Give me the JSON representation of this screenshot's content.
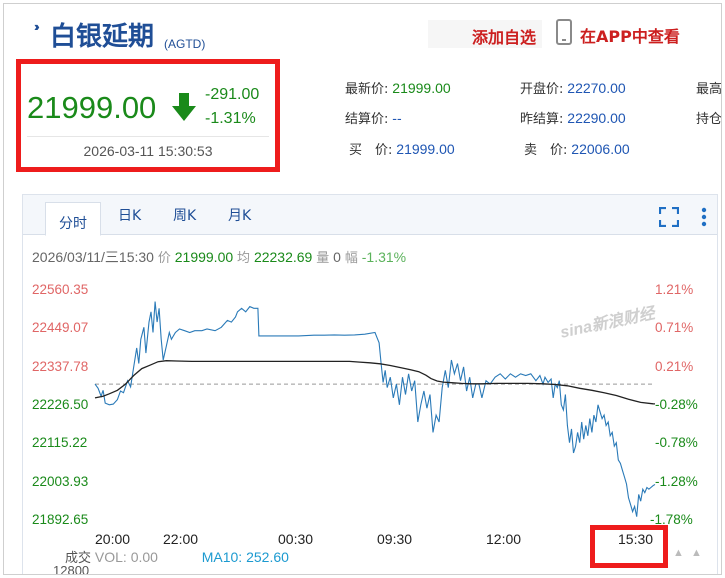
{
  "header": {
    "title": "白银延期",
    "code": "(AGTD)",
    "add_favorite": "添加自选",
    "app_link": "在APP中查看"
  },
  "price_box": {
    "price": "21999.00",
    "change": "-291.00",
    "change_pct": "-1.31%",
    "datetime": "2026-03-11 15:30:53"
  },
  "quote": {
    "latest_label": "最新价:",
    "latest": "21999.00",
    "settle_label": "结算价:",
    "settle": "--",
    "bid_label": "买　价:",
    "bid": "21999.00",
    "open_label": "开盘价:",
    "open": "22270.00",
    "prev_settle_label": "昨结算:",
    "prev_settle": "22290.00",
    "ask_label": "卖　价:",
    "ask": "22006.00",
    "high_label": "最高",
    "hold_label": "持仓"
  },
  "tabs": [
    "分时",
    "日K",
    "周K",
    "月K"
  ],
  "info_line": {
    "datetime": "2026/03/11/三15:30",
    "price_label": "价",
    "price": "21999.00",
    "avg_label": "均",
    "avg": "22232.69",
    "vol_label": "量",
    "vol": "0",
    "range_label": "幅",
    "range": "-1.31%"
  },
  "volume": {
    "label": "成交",
    "vol": "VOL: 0.00",
    "ma10": "MA10: 252.60",
    "axis_top": "12800"
  },
  "watermark": "sina新浪财经",
  "colors": {
    "up": "#e06666",
    "down": "#1a8a1a",
    "line": "#2a7ab8",
    "avg": "#222222",
    "highlight": "#ee1c1c"
  },
  "chart_data": {
    "type": "line",
    "title": "",
    "x_ticks": [
      "20:00",
      "22:00",
      "00:30",
      "09:30",
      "12:00",
      "15:30"
    ],
    "y_ticks": [
      "22560.35",
      "22449.07",
      "22337.78",
      "22226.50",
      "22115.22",
      "22003.93",
      "21892.65"
    ],
    "pct_ticks": [
      "1.21%",
      "0.71%",
      "0.21%",
      "-0.28%",
      "-0.78%",
      "-1.28%",
      "-1.78%"
    ],
    "ylim": [
      21892.65,
      22560.35
    ],
    "prev_close": 22290.0,
    "x_range": [
      0,
      550
    ],
    "series": [
      {
        "values": [
          [
            0,
            22290
          ],
          [
            3,
            22278
          ],
          [
            6,
            22255
          ],
          [
            8,
            22272
          ],
          [
            10,
            22235
          ],
          [
            14,
            22230
          ],
          [
            18,
            22232
          ],
          [
            22,
            22245
          ],
          [
            25,
            22270
          ],
          [
            28,
            22265
          ],
          [
            32,
            22300
          ],
          [
            35,
            22282
          ],
          [
            38,
            22340
          ],
          [
            41,
            22395
          ],
          [
            43,
            22350
          ],
          [
            45,
            22420
          ],
          [
            48,
            22455
          ],
          [
            50,
            22380
          ],
          [
            53,
            22470
          ],
          [
            55,
            22500
          ],
          [
            57,
            22440
          ],
          [
            59,
            22530
          ],
          [
            61,
            22470
          ],
          [
            63,
            22510
          ],
          [
            65,
            22420
          ],
          [
            67,
            22360
          ],
          [
            70,
            22400
          ],
          [
            73,
            22440
          ],
          [
            75,
            22420
          ],
          [
            79,
            22440
          ],
          [
            83,
            22450
          ],
          [
            88,
            22445
          ],
          [
            93,
            22440
          ],
          [
            98,
            22445
          ],
          [
            105,
            22445
          ],
          [
            110,
            22450
          ],
          [
            118,
            22445
          ],
          [
            124,
            22455
          ],
          [
            130,
            22475
          ],
          [
            134,
            22470
          ],
          [
            138,
            22485
          ],
          [
            140,
            22500
          ],
          [
            144,
            22510
          ],
          [
            148,
            22500
          ],
          [
            152,
            22515
          ],
          [
            156,
            22510
          ],
          [
            160,
            22510
          ],
          [
            161,
            22430
          ],
          [
            165,
            22430
          ],
          [
            172,
            22430
          ],
          [
            185,
            22430
          ],
          [
            200,
            22430
          ],
          [
            215,
            22432
          ],
          [
            225,
            22432
          ],
          [
            235,
            22433
          ],
          [
            245,
            22432
          ],
          [
            255,
            22433
          ],
          [
            265,
            22435
          ],
          [
            275,
            22440
          ],
          [
            277,
            22425
          ],
          [
            279,
            22410
          ],
          [
            281,
            22350
          ],
          [
            283,
            22295
          ],
          [
            285,
            22330
          ],
          [
            287,
            22280
          ],
          [
            290,
            22310
          ],
          [
            293,
            22250
          ],
          [
            296,
            22290
          ],
          [
            299,
            22230
          ],
          [
            302,
            22310
          ],
          [
            305,
            22260
          ],
          [
            308,
            22320
          ],
          [
            311,
            22270
          ],
          [
            314,
            22300
          ],
          [
            317,
            22180
          ],
          [
            320,
            22230
          ],
          [
            323,
            22270
          ],
          [
            326,
            22220
          ],
          [
            329,
            22260
          ],
          [
            332,
            22150
          ],
          [
            335,
            22200
          ],
          [
            338,
            22180
          ],
          [
            341,
            22280
          ],
          [
            344,
            22330
          ],
          [
            347,
            22280
          ],
          [
            350,
            22360
          ],
          [
            353,
            22320
          ],
          [
            356,
            22350
          ],
          [
            359,
            22300
          ],
          [
            362,
            22340
          ],
          [
            365,
            22270
          ],
          [
            368,
            22310
          ],
          [
            371,
            22250
          ],
          [
            374,
            22290
          ],
          [
            377,
            22290
          ],
          [
            380,
            22250
          ],
          [
            384,
            22300
          ],
          [
            388,
            22290
          ],
          [
            393,
            22310
          ],
          [
            398,
            22320
          ],
          [
            403,
            22305
          ],
          [
            408,
            22320
          ],
          [
            413,
            22310
          ],
          [
            418,
            22320
          ],
          [
            423,
            22315
          ],
          [
            428,
            22320
          ],
          [
            433,
            22300
          ],
          [
            437,
            22315
          ],
          [
            440,
            22290
          ],
          [
            442,
            22310
          ],
          [
            445,
            22295
          ],
          [
            448,
            22305
          ],
          [
            450,
            22250
          ],
          [
            452,
            22290
          ],
          [
            454,
            22280
          ],
          [
            456,
            22300
          ],
          [
            458,
            22230
          ],
          [
            460,
            22215
          ],
          [
            462,
            22260
          ],
          [
            464,
            22170
          ],
          [
            466,
            22120
          ],
          [
            468,
            22160
          ],
          [
            470,
            22090
          ],
          [
            472,
            22110
          ],
          [
            474,
            22150
          ],
          [
            476,
            22120
          ],
          [
            478,
            22180
          ],
          [
            480,
            22130
          ],
          [
            482,
            22170
          ],
          [
            484,
            22140
          ],
          [
            486,
            22190
          ],
          [
            488,
            22150
          ],
          [
            490,
            22200
          ],
          [
            492,
            22180
          ],
          [
            494,
            22230
          ],
          [
            496,
            22210
          ],
          [
            498,
            22190
          ],
          [
            500,
            22200
          ],
          [
            502,
            22170
          ],
          [
            504,
            22180
          ],
          [
            506,
            22140
          ],
          [
            508,
            22150
          ],
          [
            510,
            22110
          ],
          [
            512,
            22120
          ],
          [
            514,
            22070
          ],
          [
            516,
            22060
          ],
          [
            518,
            22040
          ],
          [
            520,
            22020
          ],
          [
            522,
            22000
          ],
          [
            524,
            21960
          ],
          [
            526,
            21940
          ],
          [
            528,
            21920
          ],
          [
            530,
            21935
          ],
          [
            532,
            21905
          ],
          [
            534,
            21970
          ],
          [
            536,
            21950
          ],
          [
            538,
            21985
          ],
          [
            540,
            21975
          ],
          [
            542,
            21990
          ],
          [
            544,
            21985
          ],
          [
            546,
            21990
          ],
          [
            548,
            21995
          ],
          [
            550,
            21999
          ]
        ]
      },
      {
        "values": [
          [
            0,
            22250
          ],
          [
            8,
            22255
          ],
          [
            14,
            22262
          ],
          [
            22,
            22272
          ],
          [
            30,
            22290
          ],
          [
            38,
            22315
          ],
          [
            46,
            22335
          ],
          [
            54,
            22345
          ],
          [
            62,
            22355
          ],
          [
            70,
            22358
          ],
          [
            80,
            22357
          ],
          [
            95,
            22356
          ],
          [
            110,
            22356
          ],
          [
            130,
            22356
          ],
          [
            150,
            22356
          ],
          [
            170,
            22356
          ],
          [
            190,
            22356
          ],
          [
            210,
            22356
          ],
          [
            230,
            22356
          ],
          [
            250,
            22356
          ],
          [
            260,
            22354
          ],
          [
            270,
            22352
          ],
          [
            280,
            22349
          ],
          [
            290,
            22344
          ],
          [
            300,
            22338
          ],
          [
            310,
            22332
          ],
          [
            318,
            22326
          ],
          [
            325,
            22316
          ],
          [
            330,
            22306
          ],
          [
            336,
            22299
          ],
          [
            342,
            22296
          ],
          [
            350,
            22294
          ],
          [
            360,
            22292
          ],
          [
            370,
            22291
          ],
          [
            380,
            22291
          ],
          [
            395,
            22292
          ],
          [
            410,
            22292
          ],
          [
            425,
            22292
          ],
          [
            440,
            22291
          ],
          [
            452,
            22289
          ],
          [
            464,
            22285
          ],
          [
            476,
            22278
          ],
          [
            488,
            22272
          ],
          [
            500,
            22265
          ],
          [
            512,
            22257
          ],
          [
            524,
            22246
          ],
          [
            536,
            22237
          ],
          [
            548,
            22233
          ],
          [
            550,
            22232.69
          ]
        ]
      }
    ]
  }
}
